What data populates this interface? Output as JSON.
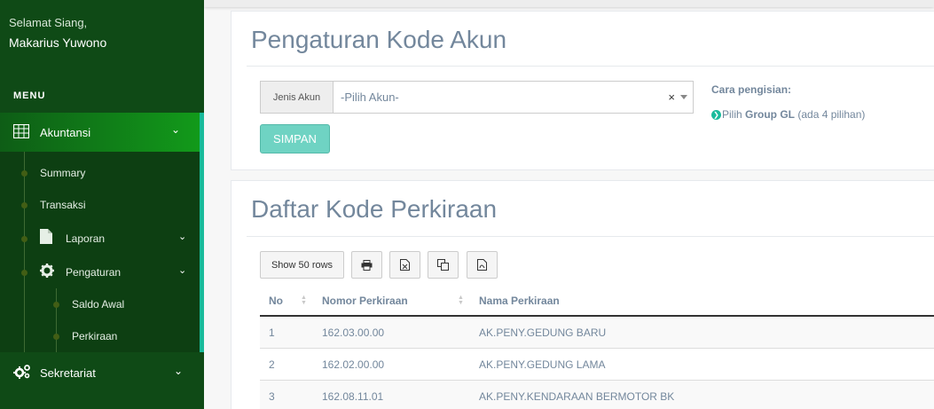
{
  "sidebar": {
    "greeting": "Selamat Siang,",
    "username": "Makarius Yuwono",
    "menu_heading": "MENU",
    "accounting": {
      "label": "Akuntansi",
      "icon": "calculator-icon",
      "items": [
        {
          "label": "Summary"
        },
        {
          "label": "Transaksi"
        },
        {
          "label": "Laporan",
          "icon": "file-icon"
        },
        {
          "label": "Pengaturan",
          "icon": "gear-icon"
        }
      ],
      "settings_items": [
        {
          "label": "Saldo Awal"
        },
        {
          "label": "Perkiraan"
        }
      ]
    },
    "secretariat": {
      "label": "Sekretariat",
      "icon": "gears-icon"
    }
  },
  "form_panel": {
    "title": "Pengaturan Kode Akun",
    "account_type_label": "Jenis Akun",
    "account_select_value": "-Pilih Akun-",
    "clear_symbol": "×",
    "save_label": "SIMPAN",
    "help_title": "Cara pengisian:",
    "help_prefix": "Pilih ",
    "help_bold": "Group GL",
    "help_suffix": " (ada 4 pilihan)"
  },
  "list_panel": {
    "title": "Daftar Kode Perkiraan",
    "show_rows_label": "Show 50 rows",
    "toolbar_icons": [
      "print-icon",
      "excel-icon",
      "copy-icon",
      "pdf-icon"
    ],
    "columns": [
      "No",
      "Nomor Perkiraan",
      "Nama Perkiraan"
    ],
    "rows": [
      {
        "no": "1",
        "nomor": "162.03.00.00",
        "nama": "AK.PENY.GEDUNG BARU"
      },
      {
        "no": "2",
        "nomor": "162.02.00.00",
        "nama": "AK.PENY.GEDUNG LAMA"
      },
      {
        "no": "3",
        "nomor": "162.08.11.01",
        "nama": "AK.PENY.KENDARAAN BERMOTOR BK"
      }
    ]
  },
  "colors": {
    "sidebar_bg": "#0f4a16",
    "active_accent": "#1abb9c",
    "save_button": "#6fd3c3",
    "text_muted": "#73879c"
  }
}
